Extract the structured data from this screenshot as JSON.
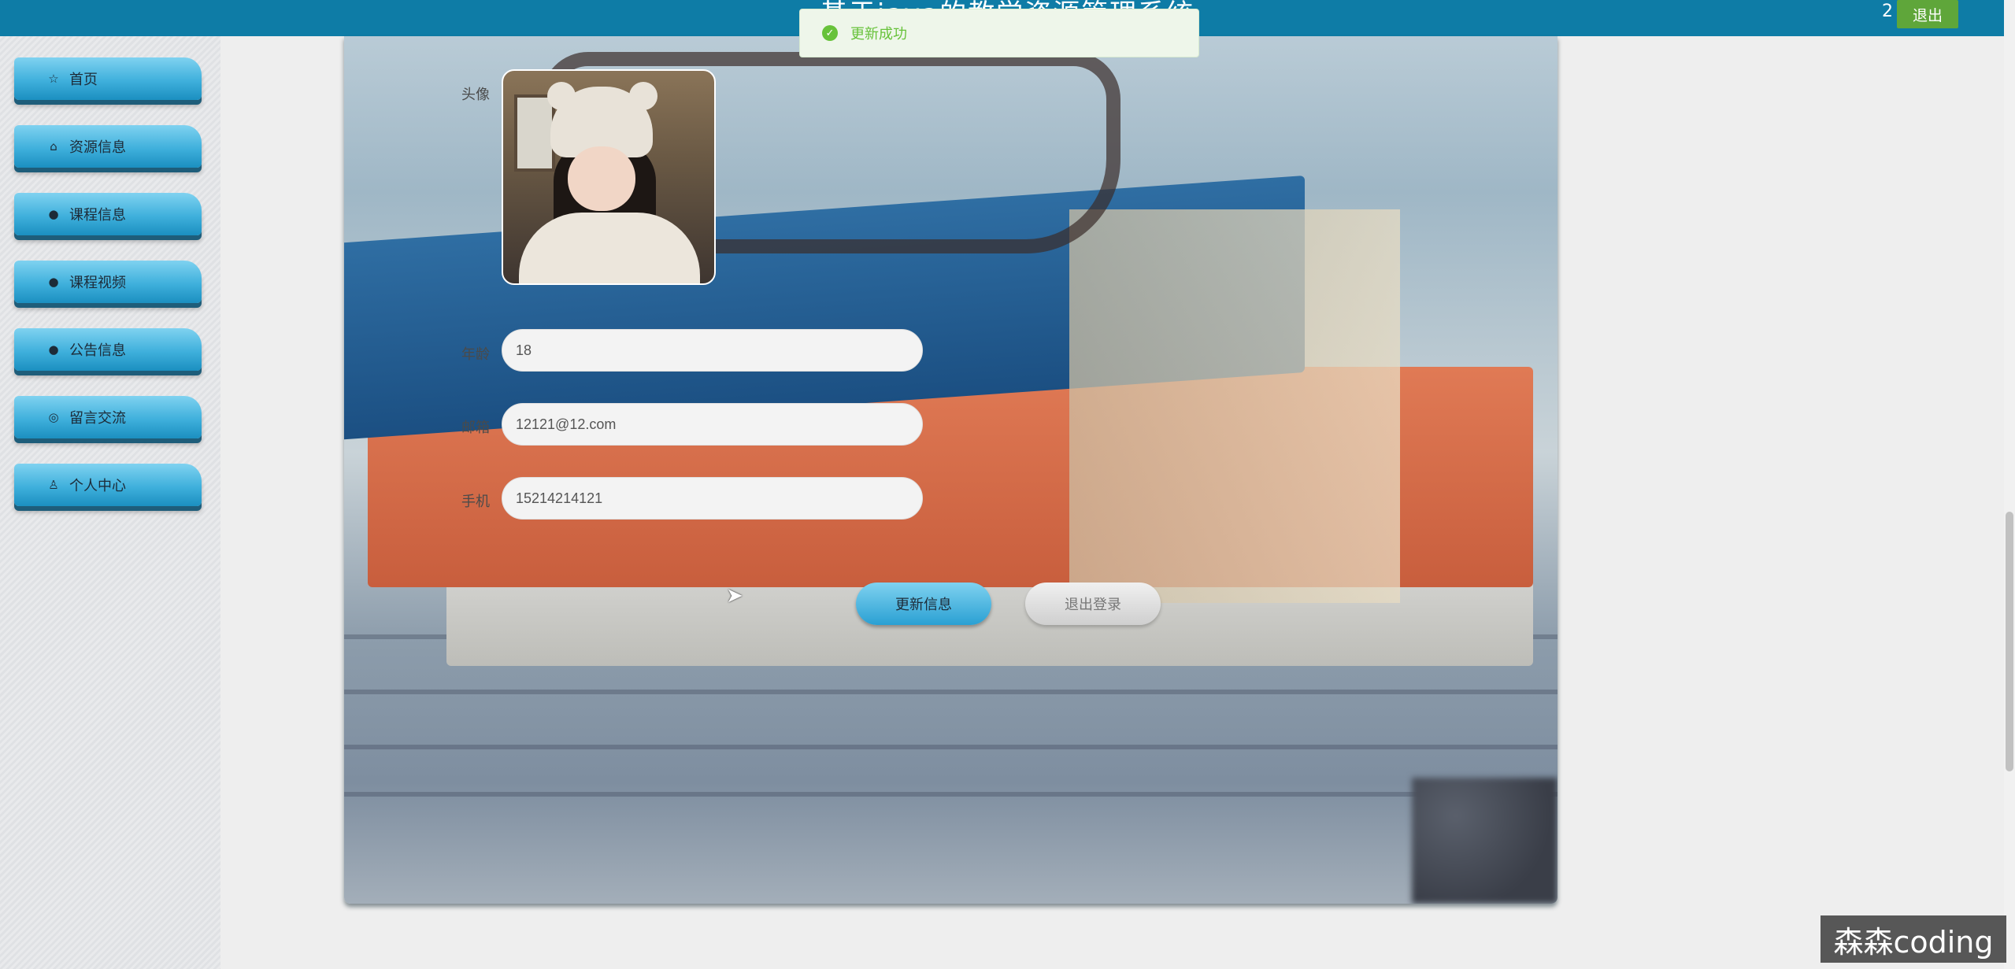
{
  "header": {
    "title": "基于java的教学资源管理系统",
    "username": "2",
    "logout_label": "退出"
  },
  "toast": {
    "message": "更新成功"
  },
  "sidebar": {
    "items": [
      {
        "label": "首页",
        "icon": "star-icon"
      },
      {
        "label": "资源信息",
        "icon": "bag-icon"
      },
      {
        "label": "课程信息",
        "icon": "info-icon"
      },
      {
        "label": "课程视频",
        "icon": "question-icon"
      },
      {
        "label": "公告信息",
        "icon": "info-icon"
      },
      {
        "label": "留言交流",
        "icon": "message-icon"
      },
      {
        "label": "个人中心",
        "icon": "user-icon"
      }
    ]
  },
  "form": {
    "avatar_label": "头像",
    "age_label": "年龄",
    "age_value": "18",
    "email_label": "邮箱",
    "email_value": "12121@12.com",
    "phone_label": "手机",
    "phone_value": "15214214121",
    "update_label": "更新信息",
    "signout_label": "退出登录"
  },
  "watermark": "森森coding"
}
